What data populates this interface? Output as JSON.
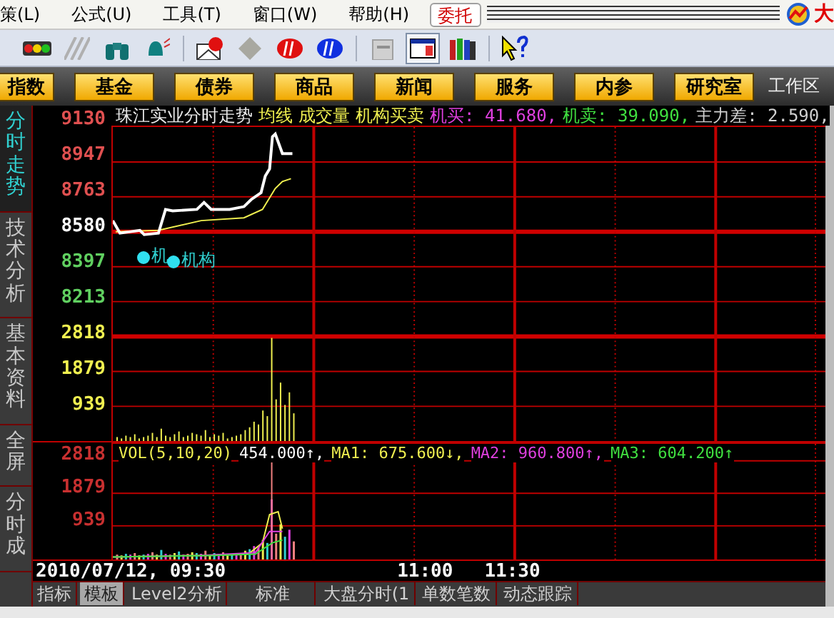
{
  "menu": [
    {
      "label": "策(L)"
    },
    {
      "label": "公式(U)"
    },
    {
      "label": "工具(T)"
    },
    {
      "label": "窗口(W)"
    },
    {
      "label": "帮助(H)"
    }
  ],
  "trade_button": "委托",
  "corner_text": "大",
  "toolbar": [
    {
      "kind": "traffic",
      "selected": false
    },
    {
      "kind": "hatch",
      "selected": false
    },
    {
      "kind": "binoculars",
      "selected": false
    },
    {
      "kind": "bell",
      "selected": false
    },
    {
      "kind": "sep"
    },
    {
      "kind": "mail",
      "selected": false
    },
    {
      "kind": "diamond",
      "selected": false
    },
    {
      "kind": "red-disc",
      "selected": false
    },
    {
      "kind": "blue-disc",
      "selected": false
    },
    {
      "kind": "sep"
    },
    {
      "kind": "clipboard",
      "selected": false
    },
    {
      "kind": "window",
      "selected": true
    },
    {
      "kind": "books",
      "selected": false
    },
    {
      "kind": "sep"
    },
    {
      "kind": "help",
      "selected": false
    }
  ],
  "nav_buttons": [
    "指数",
    "基金",
    "债券",
    "商品",
    "新闻",
    "服务",
    "内参",
    "研究室"
  ],
  "nav_text": "工作区",
  "side_tabs": [
    {
      "label": "分时走势",
      "selected": true
    },
    {
      "label": "技术分析",
      "selected": false
    },
    {
      "label": "基本资料",
      "selected": false
    },
    {
      "label": "全屏",
      "selected": false
    },
    {
      "label": "分时成",
      "selected": false
    }
  ],
  "main_pane": {
    "header": [
      {
        "text": "珠江实业分时走势",
        "kind": "title"
      },
      {
        "text": "均线",
        "kind": "indicator"
      },
      {
        "text": "成交量",
        "kind": "indicator"
      },
      {
        "text": "机构买卖",
        "kind": "indicator"
      },
      {
        "text": "机买: 41.680,",
        "kind": "buy"
      },
      {
        "text": "机卖: 39.090,",
        "kind": "sell"
      },
      {
        "text": "主力差: 2.590,",
        "kind": "diff"
      }
    ],
    "price_axis": [
      {
        "text": "9130",
        "color": "#e05050"
      },
      {
        "text": "8947",
        "color": "#e05050"
      },
      {
        "text": "8763",
        "color": "#e05050"
      },
      {
        "text": "8580",
        "color": "#ffffff"
      },
      {
        "text": "8397",
        "color": "#60d060"
      },
      {
        "text": "8213",
        "color": "#60d060"
      }
    ],
    "volume_axis": [
      "2818",
      "1879",
      "939"
    ],
    "markers": [
      "机",
      "机构"
    ]
  },
  "vol_pane": {
    "header": [
      {
        "text": "VOL(5,10,20)",
        "color": "#f0f050"
      },
      {
        "text": "454.000↑,",
        "color": "#ffffff"
      },
      {
        "text": "MA1: 675.600↓,",
        "color": "#f0f050"
      },
      {
        "text": "MA2: 960.800↑,",
        "color": "#e040e0"
      },
      {
        "text": "MA3: 604.200↑",
        "color": "#40e040"
      }
    ],
    "axis": [
      "2818",
      "1879",
      "939"
    ]
  },
  "time_axis": [
    "2010/07/12, 09:30",
    "11:00",
    "11:30"
  ],
  "bottom_tabs": [
    {
      "label": "指标",
      "selected": false
    },
    {
      "label": "模板",
      "selected": true
    },
    {
      "label": "Level2分析",
      "selected": false
    },
    {
      "label": "标准",
      "selected": false
    },
    {
      "label": "大盘分时(1",
      "selected": false
    },
    {
      "label": "单数笔数",
      "selected": false
    },
    {
      "label": "动态跟踪",
      "selected": false
    }
  ]
}
